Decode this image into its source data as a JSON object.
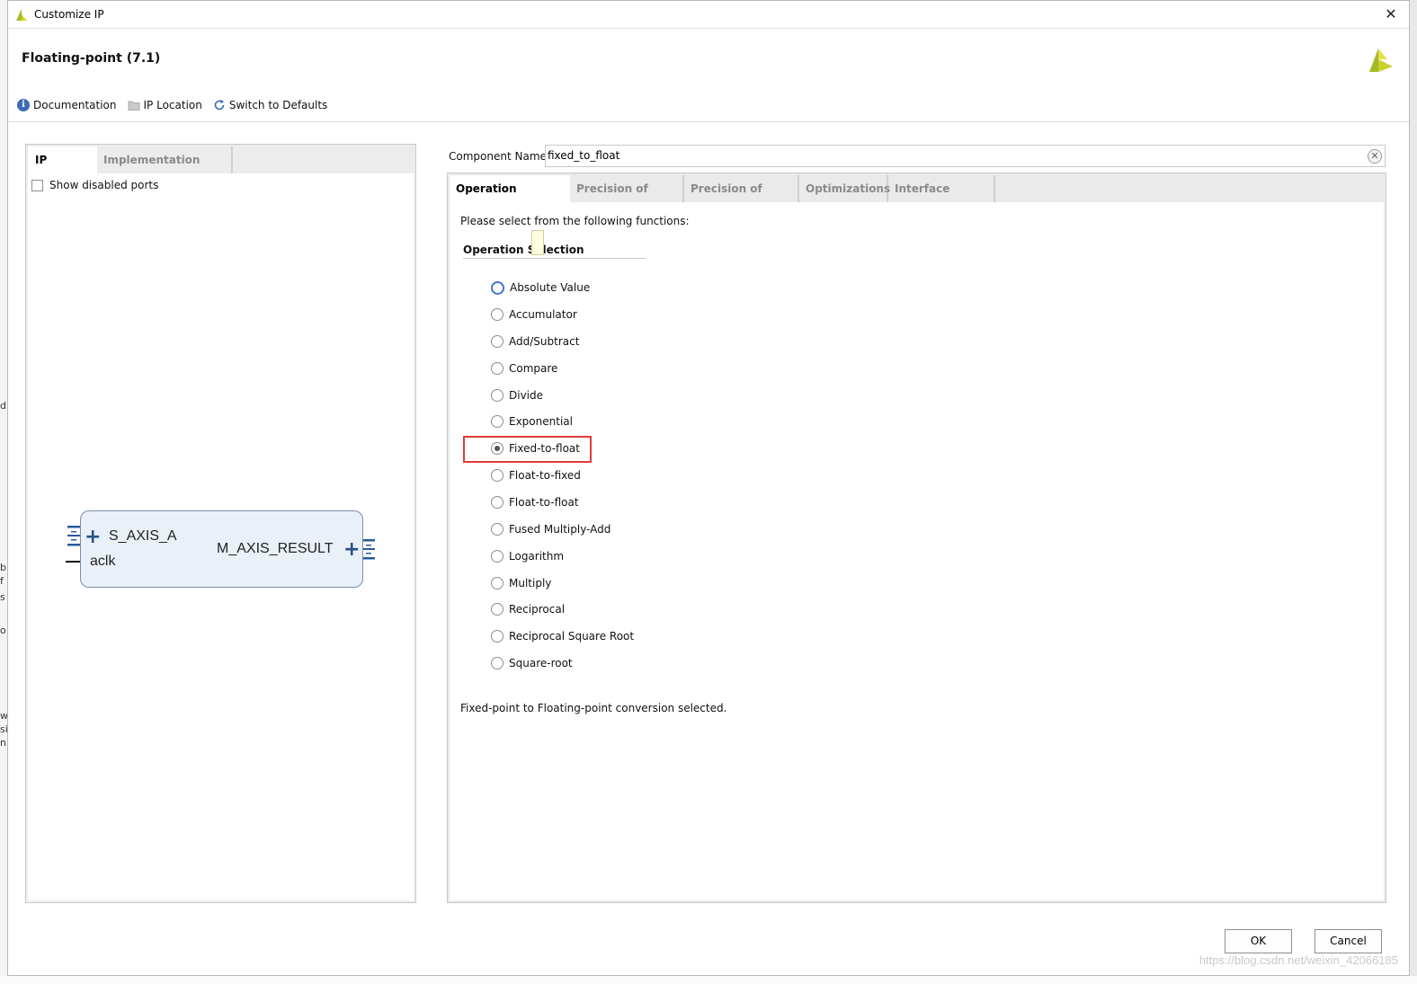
{
  "window": {
    "title": "Customize IP"
  },
  "header": {
    "ip_name": "Floating-point (7.1)",
    "toolbar": {
      "documentation": "Documentation",
      "ip_location": "IP Location",
      "switch_to_defaults": "Switch to Defaults"
    }
  },
  "left_panel": {
    "tabs": [
      "IP Symbol",
      "Implementation Details"
    ],
    "active_tab": "IP Symbol",
    "show_disabled_ports": {
      "label": "Show disabled ports",
      "checked": false
    },
    "symbol": {
      "input_port": "S_AXIS_A",
      "clock_port": "aclk",
      "output_port": "M_AXIS_RESULT"
    }
  },
  "component": {
    "label": "Component Name",
    "value": "fixed_to_float"
  },
  "right_tabs": [
    "Operation Selection",
    "Precision of Inputs",
    "Precision of Result",
    "Optimizations",
    "Interface Options"
  ],
  "operation": {
    "prompt": "Please select from the following functions:",
    "group_title": "Operation Selection",
    "options": [
      "Absolute Value",
      "Accumulator",
      "Add/Subtract",
      "Compare",
      "Divide",
      "Exponential",
      "Fixed-to-float",
      "Float-to-fixed",
      "Float-to-float",
      "Fused Multiply-Add",
      "Logarithm",
      "Multiply",
      "Reciprocal",
      "Reciprocal Square Root",
      "Square-root"
    ],
    "selected": "Fixed-to-float",
    "status": "Fixed-point to Floating-point conversion selected."
  },
  "buttons": {
    "ok": "OK",
    "cancel": "Cancel"
  },
  "watermark": "https://blog.csdn.net/weixin_42066185",
  "colors": {
    "highlight": "#e23b3b",
    "accent": "#3b7ad1",
    "brand_logo": "#a4b82a"
  }
}
